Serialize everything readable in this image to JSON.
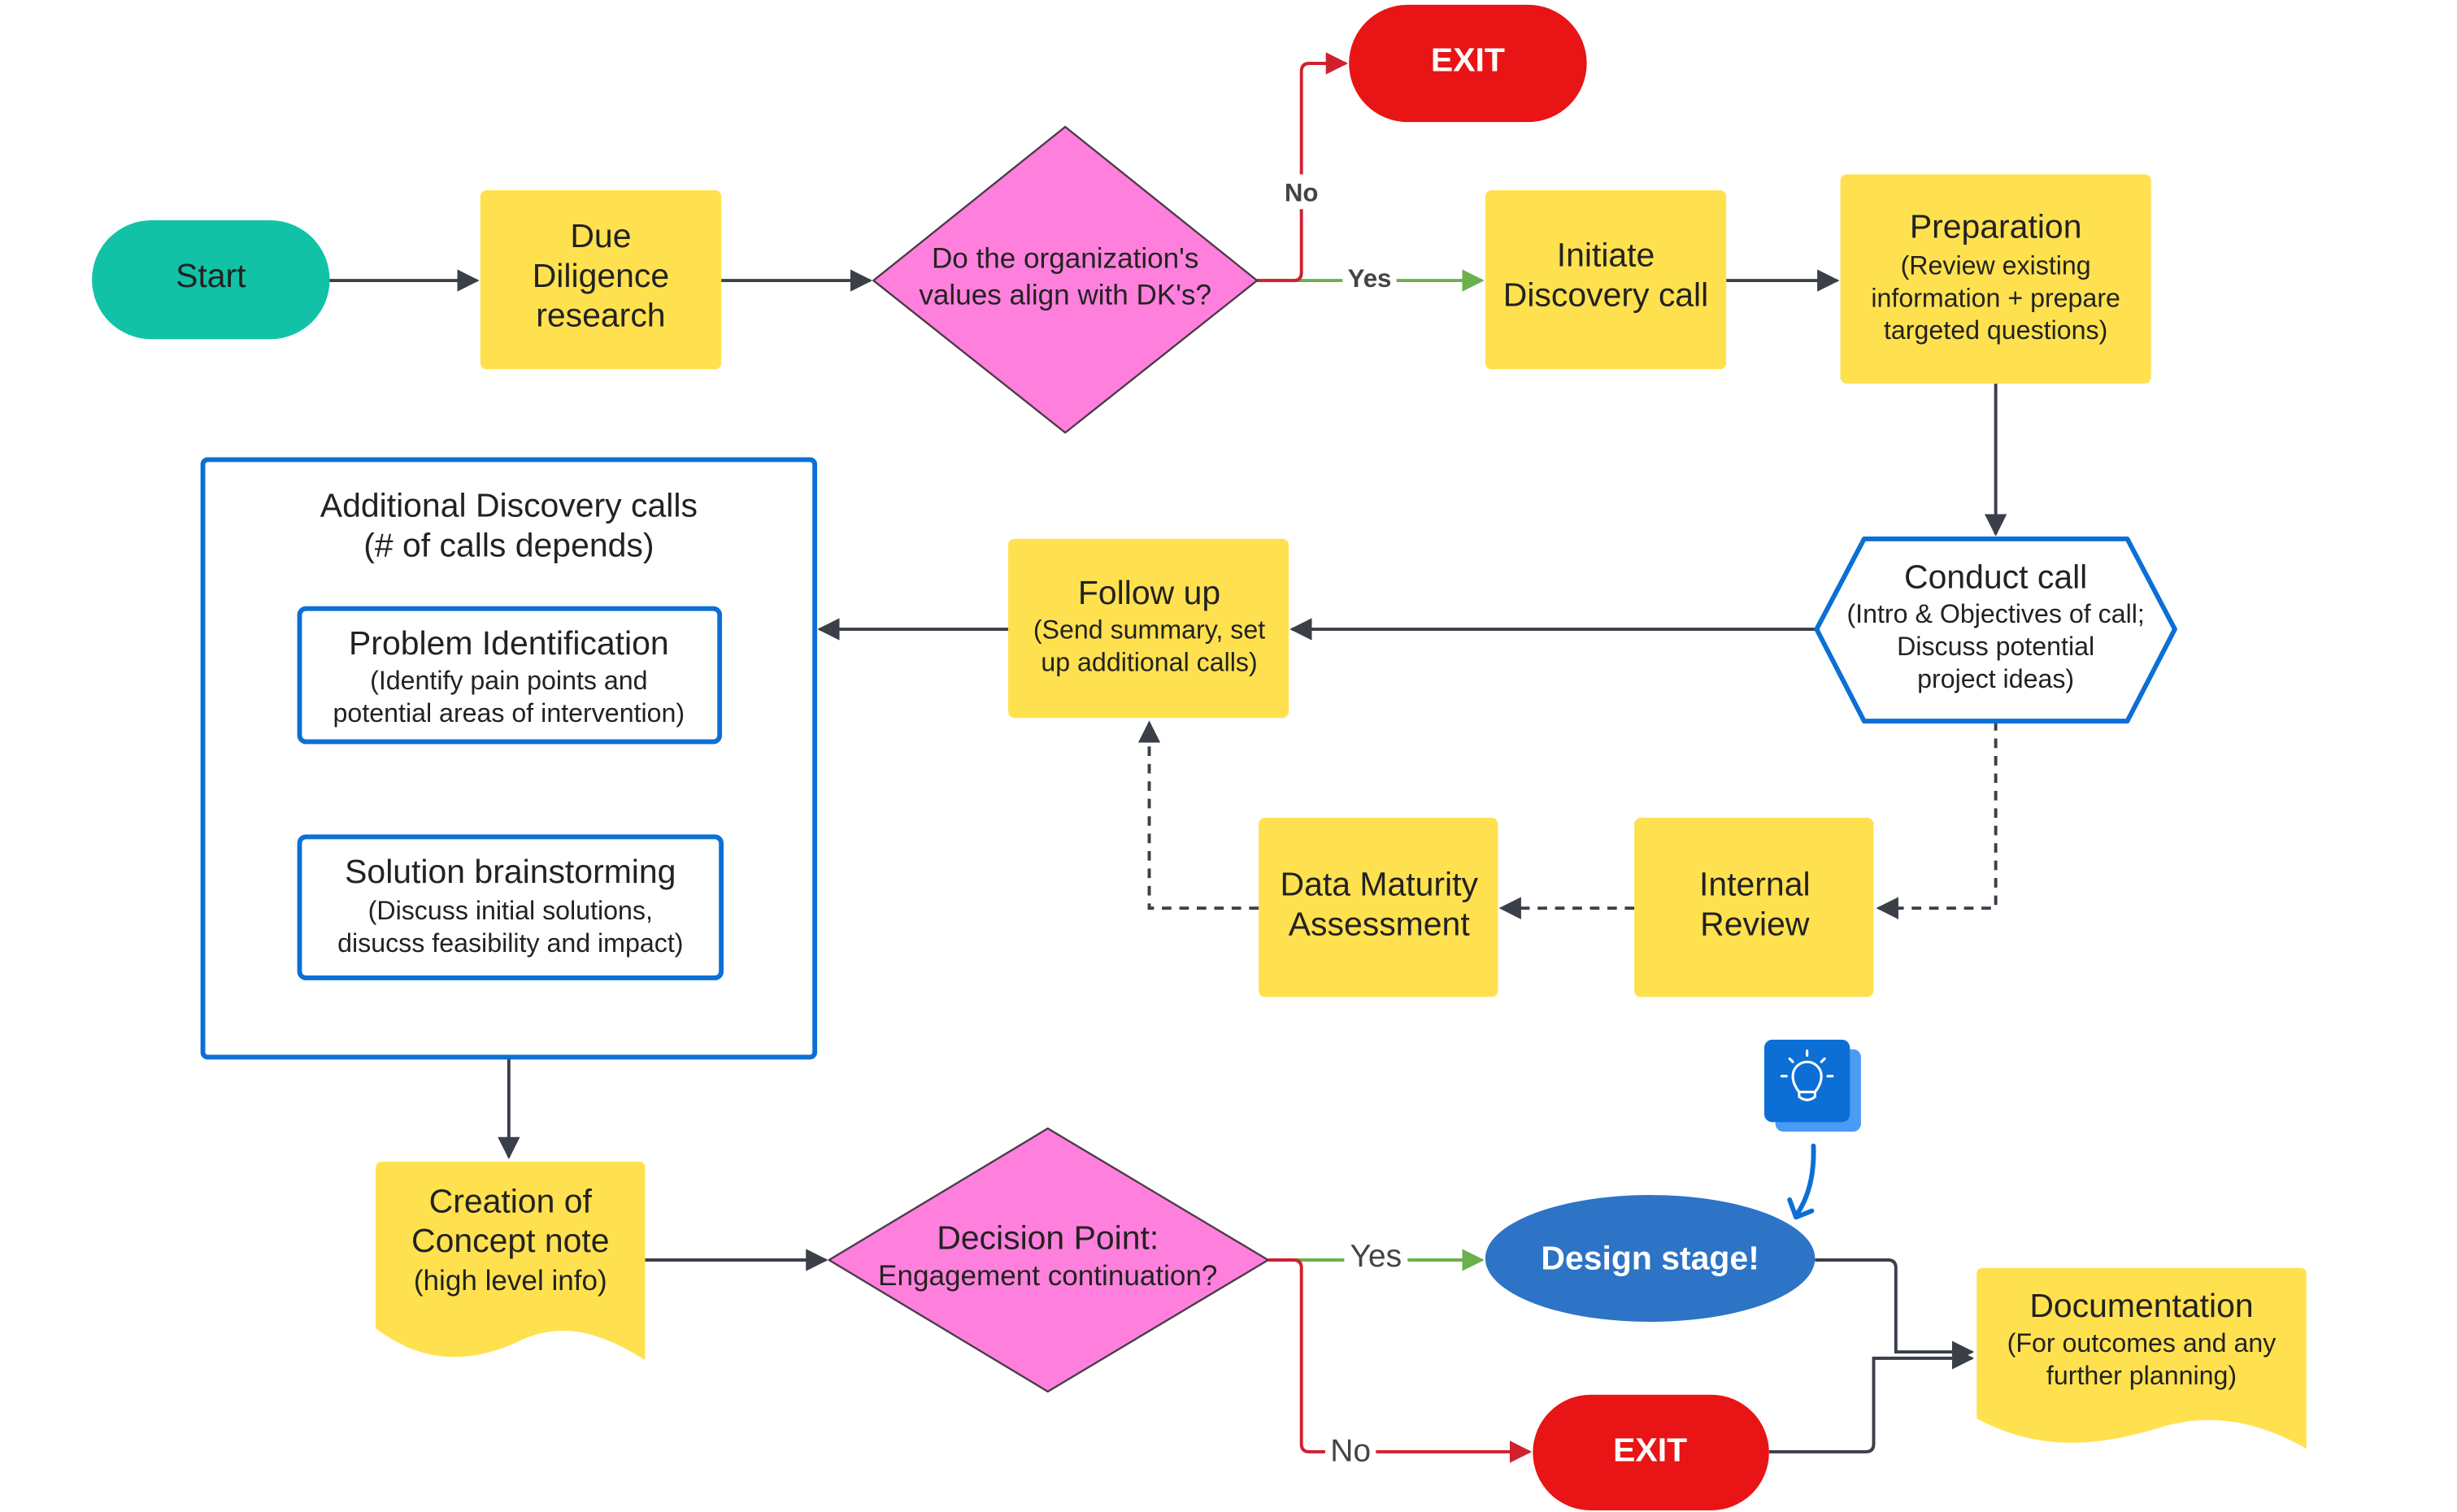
{
  "colors": {
    "process": "#ffe14f",
    "start": "#12c2a6",
    "exit": "#e81416",
    "decision": "#ff80dc",
    "design": "#2d74c6",
    "outline": "#0b6fd6",
    "yes": "#6ab04c",
    "no": "#d0202e"
  },
  "nodes": {
    "start": {
      "lines": [
        "Start"
      ]
    },
    "due_diligence": {
      "lines": [
        "Due",
        "Diligence",
        "research"
      ]
    },
    "decision_values": {
      "lines": [
        "Do the organization's",
        "values align with DK's?"
      ]
    },
    "exit_top": {
      "lines": [
        "EXIT"
      ]
    },
    "initiate": {
      "lines": [
        "Initiate",
        "Discovery call"
      ]
    },
    "preparation": {
      "title": "Preparation",
      "lines": [
        "(Review existing",
        "information + prepare",
        "targeted questions)"
      ]
    },
    "conduct_call": {
      "title": "Conduct call",
      "lines": [
        "(Intro & Objectives of call;",
        "Discuss potential",
        "project ideas)"
      ]
    },
    "follow_up": {
      "title": "Follow up",
      "lines": [
        "(Send summary, set",
        "up additional calls)"
      ]
    },
    "additional_calls": {
      "lines": [
        "Additional Discovery calls",
        "(# of calls depends)"
      ]
    },
    "problem_id": {
      "title": "Problem Identification",
      "lines": [
        "(Identify pain points and",
        "potential areas of intervention)"
      ]
    },
    "solution": {
      "title": "Solution brainstorming",
      "lines": [
        "(Discuss initial solutions,",
        "disucss feasibility and impact)"
      ]
    },
    "data_maturity": {
      "lines": [
        "Data Maturity",
        "Assessment"
      ]
    },
    "internal_review": {
      "lines": [
        "Internal",
        "Review"
      ]
    },
    "concept_note": {
      "lines": [
        "Creation of",
        "Concept note",
        "(high level info)"
      ]
    },
    "decision_engagement": {
      "lines": [
        "Decision Point:",
        "Engagement continuation?"
      ]
    },
    "design_stage": {
      "lines": [
        "Design stage!"
      ]
    },
    "exit_bottom": {
      "lines": [
        "EXIT"
      ]
    },
    "documentation": {
      "title": "Documentation",
      "lines": [
        "(For outcomes and any",
        "further planning)"
      ]
    }
  },
  "edge_labels": {
    "yes1": "Yes",
    "no1": "No",
    "yes2": "Yes",
    "no2": "No"
  },
  "icons": {
    "idea": "lightbulb-icon"
  }
}
